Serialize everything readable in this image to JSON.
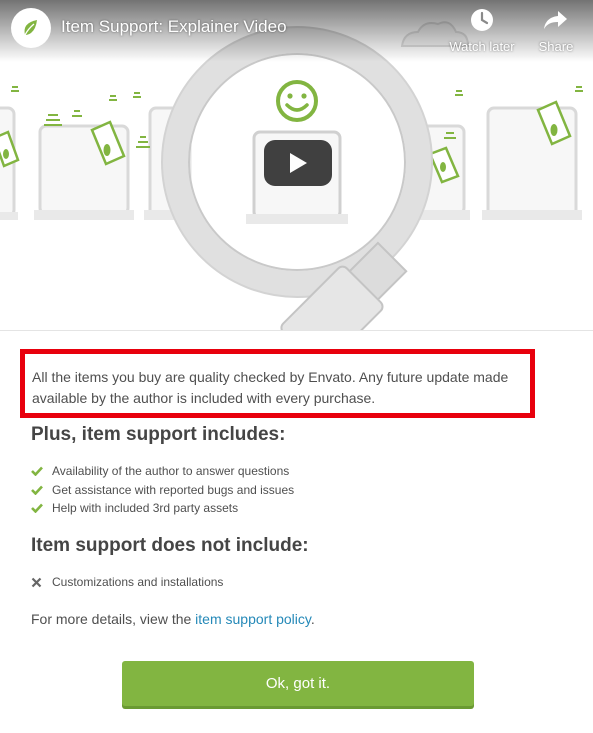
{
  "video": {
    "title": "Item Support: Explainer Video",
    "actions": {
      "watch_later_label": "Watch later",
      "share_label": "Share"
    },
    "colors": {
      "envato_green": "#82b541",
      "youtube_play_bg": "#212121"
    }
  },
  "notice": {
    "text": "All the items you buy are quality checked by Envato. Any future update made available by the author is included with every purchase.",
    "highlight_color": "#e8000d"
  },
  "includes": {
    "heading": "Plus, item support includes:",
    "items": [
      "Availability of the author to answer questions",
      "Get assistance with reported bugs and issues",
      "Help with included 3rd party assets"
    ]
  },
  "excludes": {
    "heading": "Item support does not include:",
    "items": [
      "Customizations and installations"
    ]
  },
  "details": {
    "prefix": "For more details, view the ",
    "link_text": "item support policy",
    "suffix": "."
  },
  "ok_button": {
    "label": "Ok, got it.",
    "color": "#82b541"
  }
}
